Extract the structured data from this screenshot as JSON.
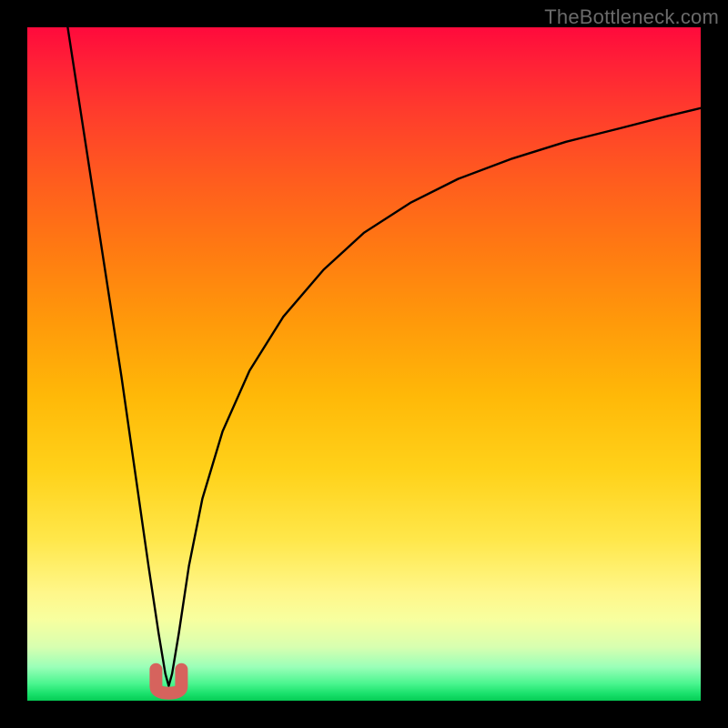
{
  "watermark": "TheBottleneck.com",
  "chart_data": {
    "type": "line",
    "title": "",
    "xlabel": "",
    "ylabel": "",
    "xlim": [
      0,
      100
    ],
    "ylim": [
      0,
      100
    ],
    "grid": false,
    "legend": false,
    "series": [
      {
        "name": "bottleneck-curve",
        "description": "V-shaped curve: steep drop from top-left to a near-zero minimum around x≈21, then rises concavely toward top-right, reaching ~88 at x=100.",
        "color": "#000000",
        "x": [
          6,
          8,
          10,
          12,
          14,
          16,
          18,
          19.5,
          20.5,
          21,
          21.5,
          22.5,
          24,
          26,
          29,
          33,
          38,
          44,
          50,
          57,
          64,
          72,
          80,
          88,
          95,
          100
        ],
        "y": [
          100,
          87,
          74,
          61,
          48,
          34,
          20,
          10,
          4,
          2.2,
          4,
          10,
          20,
          30,
          40,
          49,
          57,
          64,
          69.5,
          74,
          77.5,
          80.5,
          83,
          85,
          86.8,
          88
        ]
      },
      {
        "name": "minimum-marker",
        "description": "Small rounded red U marker at the curve minimum.",
        "color": "#d6635d",
        "x": [
          21
        ],
        "y": [
          2.2
        ]
      }
    ],
    "background_gradient": {
      "direction": "top-to-bottom",
      "stops": [
        {
          "pos": 0.0,
          "color": "#ff0a3c"
        },
        {
          "pos": 0.33,
          "color": "#ff7a12"
        },
        {
          "pos": 0.66,
          "color": "#ffd21a"
        },
        {
          "pos": 0.88,
          "color": "#f7ff9f"
        },
        {
          "pos": 1.0,
          "color": "#06cc55"
        }
      ]
    }
  }
}
